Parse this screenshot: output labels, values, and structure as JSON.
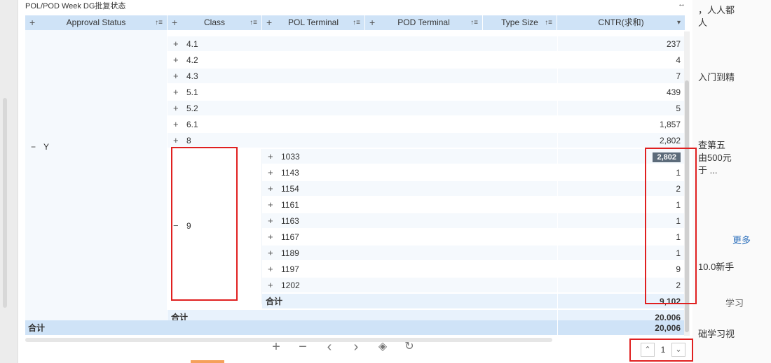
{
  "title": "POL/POD Week DG批复状态",
  "columns": [
    {
      "label": "Approval Status",
      "plus": "+",
      "sort": "↑≡"
    },
    {
      "label": "Class",
      "plus": "+",
      "sort": "↑≡"
    },
    {
      "label": "POL Terminal",
      "plus": "+",
      "sort": "↑≡"
    },
    {
      "label": "POD Terminal",
      "plus": "+",
      "sort": "↑≡"
    },
    {
      "label": "Type Size",
      "sort": "↑≡"
    },
    {
      "label": "CNTR(求和)",
      "sort": "▾"
    }
  ],
  "approval_value": "Y",
  "class_rows": [
    {
      "label": "4.1",
      "value": "237"
    },
    {
      "label": "4.2",
      "value": "4"
    },
    {
      "label": "4.3",
      "value": "7"
    },
    {
      "label": "5.1",
      "value": "439"
    },
    {
      "label": "5.2",
      "value": "5"
    },
    {
      "label": "6.1",
      "value": "1,857"
    },
    {
      "label": "8",
      "value": "2,802"
    }
  ],
  "class_9": {
    "label": "9",
    "terminals": [
      {
        "label": "1033",
        "value": "2,802"
      },
      {
        "label": "1143",
        "value": "1"
      },
      {
        "label": "1154",
        "value": "2"
      },
      {
        "label": "1161",
        "value": "1"
      },
      {
        "label": "1163",
        "value": "1"
      },
      {
        "label": "1167",
        "value": "1"
      },
      {
        "label": "1189",
        "value": "1"
      },
      {
        "label": "1197",
        "value": "9"
      },
      {
        "label": "1202",
        "value": "2"
      }
    ],
    "subtotal_label": "合计",
    "subtotal_value": "9,102"
  },
  "y_subtotal_label": "合计",
  "y_subtotal_value": "20,006",
  "grand_total_label": "合计",
  "grand_total_value": "20,006",
  "pager": {
    "page": "1"
  },
  "right_pane": {
    "t1": "，人人都",
    "t2": "人",
    "t3": "入门到精",
    "t4": "查第五",
    "t5": "由500元",
    "t6": "于 ...",
    "more": "更多",
    "t7": "10.0新手",
    "t8": "学习",
    "t9": "础学习视"
  }
}
